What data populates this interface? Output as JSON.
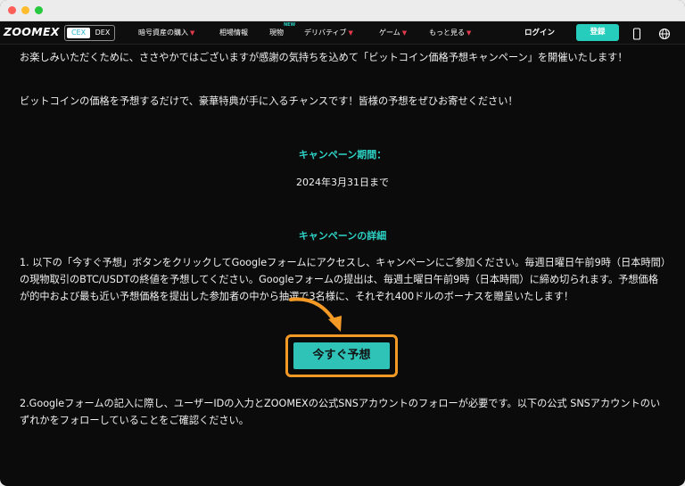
{
  "nav": {
    "logo": "ZOOMEX",
    "cex": "CEX",
    "dex": "DEX",
    "items": [
      "暗号資産の購入",
      "相場情報",
      "現物",
      "デリバティブ",
      "ゲーム",
      "もっと見る"
    ],
    "new_badge": "NEW",
    "login": "ログイン",
    "signup": "登録",
    "icons": [
      "mobile-icon",
      "globe-icon"
    ]
  },
  "content": {
    "intro": "お楽しみいただくために、ささやかではございますが感謝の気持ちを込めて「ビットコイン価格予想キャンペーン」を開催いたします！",
    "intro2": "ビットコインの価格を予想するだけで、豪華特典が手に入るチャンスです！皆様の予想をぜひお寄せください！",
    "period_title": "キャンペーン期間：",
    "period_value": "2024年3月31日まで",
    "details_title": "キャンペーンの詳細",
    "detail1": "1. 以下の「今すぐ予想」ボタンをクリックしてGoogleフォームにアクセスし、キャンペーンにご参加ください。毎週日曜日午前9時（日本時間）の現物取引のBTC/USDTの終値を予想してください。Googleフォームの提出は、毎週土曜日午前9時（日本時間）に締め切られます。予想価格が的中および最も近い予想価格を提出した参加者の中から抽選で3名様に、それぞれ400ドルのボーナスを贈呈いたします！",
    "cta": "今すぐ予想",
    "detail2": "2.Googleフォームの記入に際し、ユーザーIDの入力とZOOMEXの公式SNSアカウントのフォローが必要です。以下の公式 SNSアカウントのいずれかをフォローしていることをご確認ください。"
  },
  "colors": {
    "accent": "#2ed3c5",
    "highlight": "#f39a26",
    "background": "#0b0b0b"
  }
}
